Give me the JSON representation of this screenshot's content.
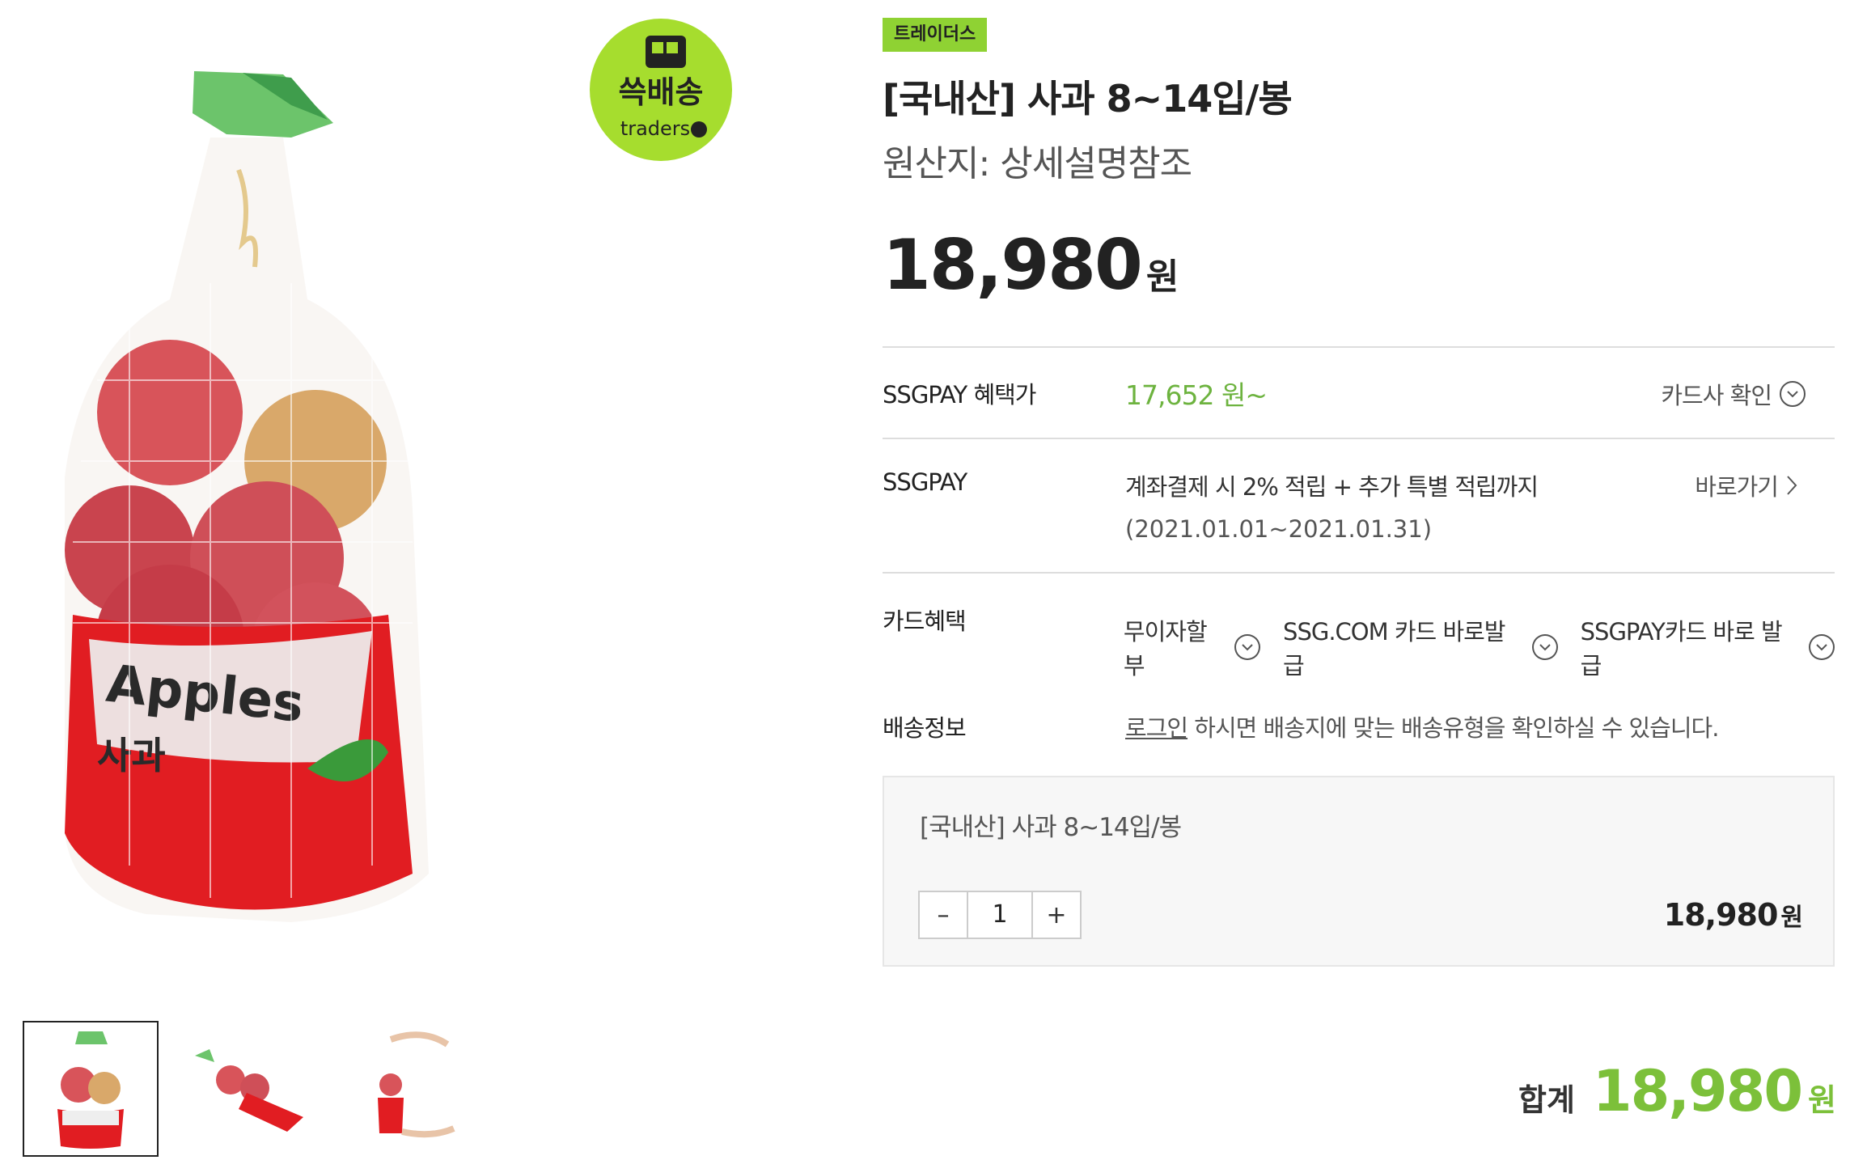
{
  "product": {
    "brand_badge": "트레이더스",
    "title": "[국내산] 사과 8~14입/봉",
    "origin": "원산지: 상세설명참조",
    "price": "18,980",
    "price_unit": "원"
  },
  "benefit": {
    "label": "SSGPAY 혜택가",
    "value": "17,652 원~",
    "action": "카드사 확인"
  },
  "ssgpay": {
    "label": "SSGPAY",
    "desc": "계좌결제 시 2% 적립 + 추가 특별 적립까지",
    "period": "(2021.01.01~2021.01.31)",
    "action": "바로가기"
  },
  "card": {
    "label": "카드혜택",
    "options": [
      "무이자할부",
      "SSG.COM 카드 바로발급",
      "SSGPAY카드 바로 발급"
    ]
  },
  "shipping": {
    "label": "배송정보",
    "login_link": "로그인",
    "message": " 하시면 배송지에 맞는 배송유형을 확인하실 수 있습니다."
  },
  "order": {
    "item_name": "[국내산] 사과 8~14입/봉",
    "quantity": "1",
    "minus": "–",
    "plus": "+",
    "price": "18,980",
    "price_unit": "원"
  },
  "total": {
    "label": "합계",
    "price": "18,980",
    "unit": "원"
  },
  "logo": {
    "text_top": "쓱배송",
    "text_bottom": "traders"
  },
  "bag": {
    "text_en": "Apples",
    "text_ko": "사과"
  },
  "colors": {
    "accent_green": "#8fd233",
    "price_green": "#7cc03a",
    "benefit_green": "#6db33f"
  },
  "thumbnails": [
    {
      "name": "thumb-front",
      "active": true
    },
    {
      "name": "thumb-side",
      "active": false
    },
    {
      "name": "thumb-hand",
      "active": false
    }
  ]
}
